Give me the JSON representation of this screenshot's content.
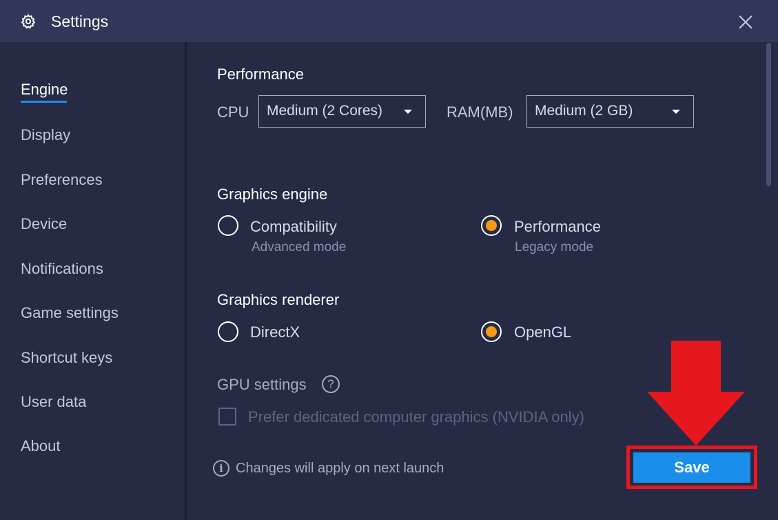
{
  "window": {
    "title": "Settings",
    "icons": {
      "title": "gear-icon",
      "close": "close-icon"
    }
  },
  "sidebar": {
    "items": [
      {
        "label": "Engine",
        "active": true
      },
      {
        "label": "Display"
      },
      {
        "label": "Preferences"
      },
      {
        "label": "Device"
      },
      {
        "label": "Notifications"
      },
      {
        "label": "Game settings"
      },
      {
        "label": "Shortcut keys"
      },
      {
        "label": "User data"
      },
      {
        "label": "About"
      }
    ]
  },
  "performance": {
    "title": "Performance",
    "cpu_label": "CPU",
    "cpu_value": "Medium (2 Cores)",
    "ram_label": "RAM(MB)",
    "ram_value": "Medium (2 GB)"
  },
  "graphics_engine": {
    "title": "Graphics engine",
    "options": [
      {
        "label": "Compatibility",
        "sub": "Advanced mode",
        "checked": false
      },
      {
        "label": "Performance",
        "sub": "Legacy mode",
        "checked": true
      }
    ]
  },
  "graphics_renderer": {
    "title": "Graphics renderer",
    "options": [
      {
        "label": "DirectX",
        "checked": false
      },
      {
        "label": "OpenGL",
        "checked": true
      }
    ]
  },
  "gpu": {
    "title": "GPU settings",
    "help_glyph": "?",
    "checkbox_label": "Prefer dedicated computer graphics (NVIDIA only)",
    "checkbox_checked": false
  },
  "footer": {
    "info_glyph": "i",
    "info_text": "Changes will apply on next launch",
    "save_label": "Save"
  },
  "colors": {
    "background": "#262a45",
    "titlebar": "#32375a",
    "accent": "#1493ea",
    "radio_selected": "#f39c12",
    "save_button": "#1b8eea",
    "highlight": "#e8161f"
  }
}
